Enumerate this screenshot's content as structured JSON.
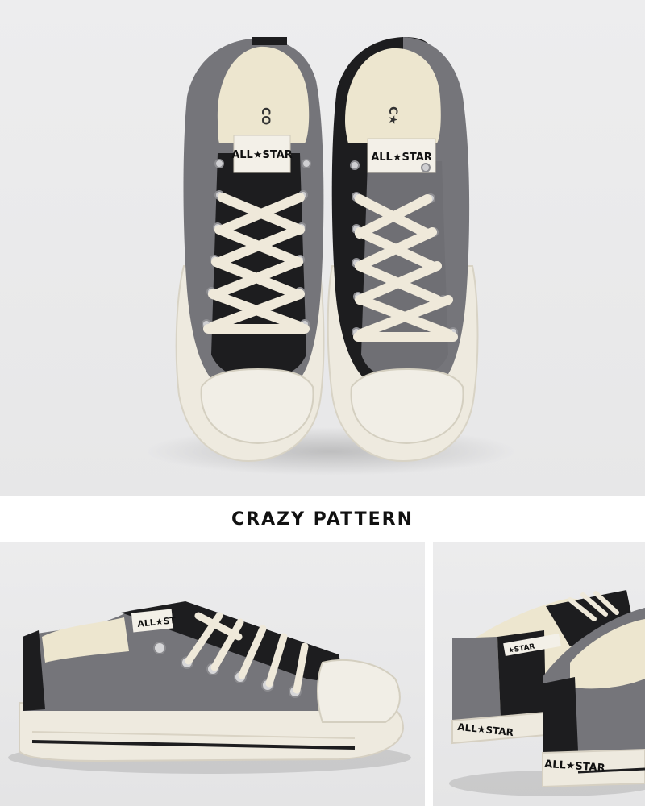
{
  "banner": {
    "title": "CRAZY PATTERN"
  },
  "photos": {
    "hero": {
      "tongue_label": "ALL★STAR",
      "insole_left": "CO",
      "insole_right": "C★"
    },
    "side": {
      "tongue_label": "ALL★ST"
    },
    "heel": {
      "heel_label_1": "ALL★STAR",
      "heel_label_2": "ALL★STAR",
      "tongue_label": "★STAR"
    }
  },
  "colors": {
    "canvas_grey": "#75757a",
    "canvas_black": "#1d1d1f",
    "sole_cream": "#eeeadf",
    "lace": "#efe9da"
  }
}
